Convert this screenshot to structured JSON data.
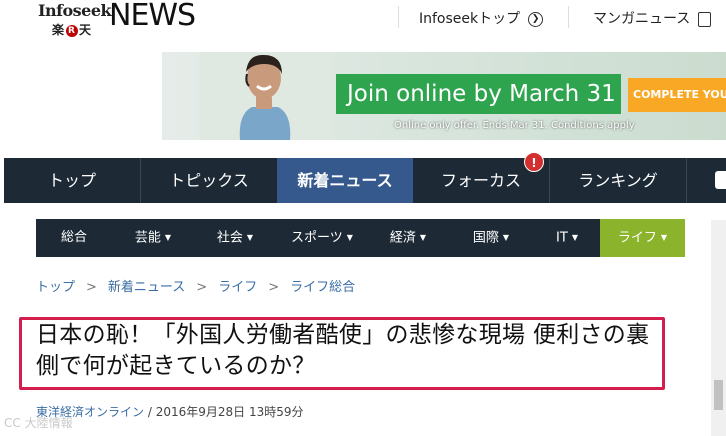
{
  "brand": {
    "infoseek": "Infoseek",
    "rakuten": "楽天",
    "rakuten_r": "R",
    "news": "NEWS"
  },
  "header_links": [
    {
      "label": "Infoseekトップ",
      "icon": "arrow-right-circle-icon"
    },
    {
      "label": "マンガニュース",
      "icon": "document-icon"
    }
  ],
  "ad": {
    "cta": "Join online by March 31",
    "button": "COMPLETE YOUR",
    "fine_print": "Online only offer. Ends Mar 31. Conditions apply"
  },
  "main_nav": {
    "items": [
      "トップ",
      "トピックス",
      "新着ニュース",
      "フォーカス",
      "ランキング"
    ],
    "active_index": 2,
    "notice_badge": "!"
  },
  "sub_nav": {
    "items": [
      "総合",
      "芸能",
      "社会",
      "スポーツ",
      "経済",
      "国際",
      "IT",
      "ライフ"
    ],
    "active_index": 7
  },
  "breadcrumb": [
    "トップ",
    "新着ニュース",
    "ライフ",
    "ライフ総合"
  ],
  "article": {
    "title": "日本の恥！「外国人労働者酷使」の悲惨な現場 便利さの裏側で何が起きているのか？",
    "source": "東洋経済オンライン",
    "date": "2016年9月28日 13時59分"
  },
  "watermark": "CC 大陸情報",
  "colors": {
    "nav_bg": "#1d2a36",
    "nav_active": "#35598c",
    "subnav_active": "#8bb32b",
    "highlight_border": "#d41e4d",
    "link": "#3a6ea5",
    "ad_green": "#2ea44f",
    "ad_orange": "#f9a825"
  }
}
